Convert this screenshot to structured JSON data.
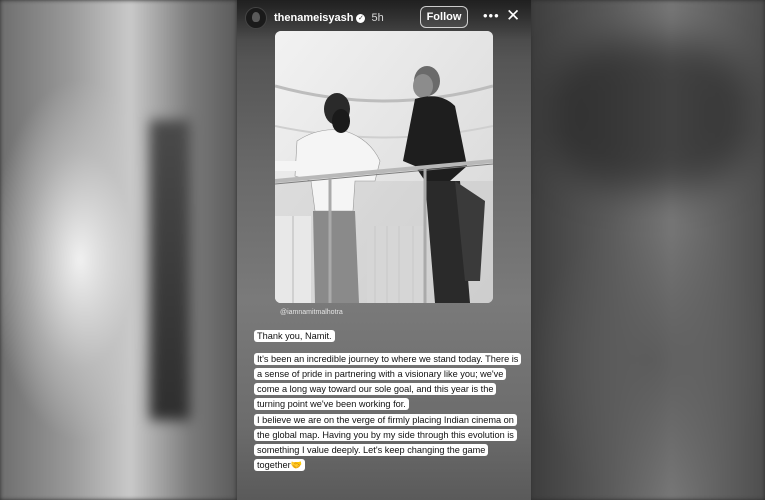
{
  "story": {
    "username": "thenameisyash",
    "verified_glyph": "✓",
    "time": "5h",
    "follow_label": "Follow",
    "more_glyph": "•••",
    "close_glyph": "✕"
  },
  "photo": {
    "credit": "@iamnamitmalhotra"
  },
  "caption": {
    "p1": "Thank you, Namit.",
    "p2": "It's been an incredible journey to where we stand today. There is a sense of pride in partnering with a visionary like you; we've come a long way toward our sole goal, and this year is the turning point we've been working for.",
    "p3": "I believe we are on the verge of firmly placing Indian cinema on the global map. Having you by my side through this evolution is something I value deeply. Let's keep changing the game together🤝"
  },
  "icons": {
    "avatar": "avatar",
    "verified": "verified-badge-icon",
    "more": "more-options-icon",
    "close": "close-icon"
  }
}
